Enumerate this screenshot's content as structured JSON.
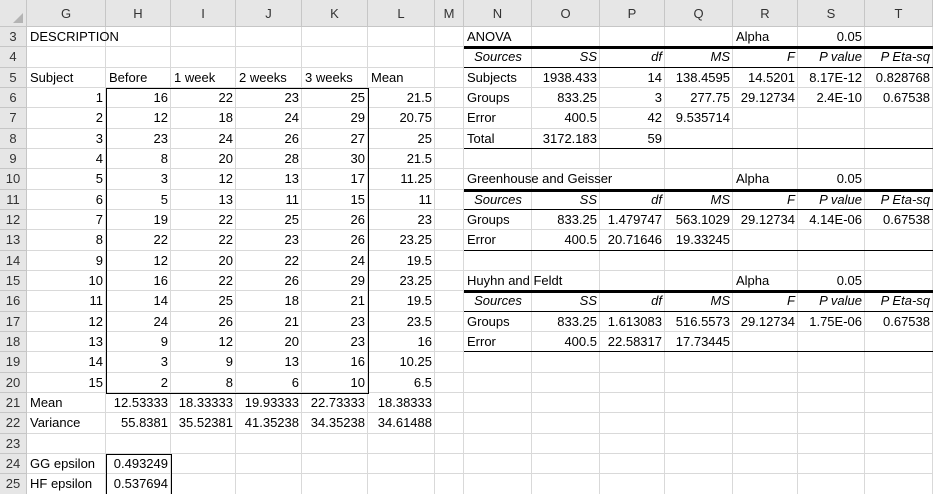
{
  "columns": [
    "G",
    "H",
    "I",
    "J",
    "K",
    "L",
    "M",
    "N",
    "O",
    "P",
    "Q",
    "R",
    "S",
    "T"
  ],
  "rows": [
    "3",
    "4",
    "5",
    "6",
    "7",
    "8",
    "9",
    "10",
    "11",
    "12",
    "13",
    "14",
    "15",
    "16",
    "17",
    "18",
    "19",
    "20",
    "21",
    "22",
    "23",
    "24",
    "25"
  ],
  "left": {
    "title": "DESCRIPTION",
    "headers": [
      "Subject",
      "Before",
      "1 week",
      "2 weeks",
      "3 weeks",
      "Mean"
    ],
    "data": [
      [
        "1",
        "16",
        "22",
        "23",
        "25",
        "21.5"
      ],
      [
        "2",
        "12",
        "18",
        "24",
        "29",
        "20.75"
      ],
      [
        "3",
        "23",
        "24",
        "26",
        "27",
        "25"
      ],
      [
        "4",
        "8",
        "20",
        "28",
        "30",
        "21.5"
      ],
      [
        "5",
        "3",
        "12",
        "13",
        "17",
        "11.25"
      ],
      [
        "6",
        "5",
        "13",
        "11",
        "15",
        "11"
      ],
      [
        "7",
        "19",
        "22",
        "25",
        "26",
        "23"
      ],
      [
        "8",
        "22",
        "22",
        "23",
        "26",
        "23.25"
      ],
      [
        "9",
        "12",
        "20",
        "22",
        "24",
        "19.5"
      ],
      [
        "10",
        "16",
        "22",
        "26",
        "29",
        "23.25"
      ],
      [
        "11",
        "14",
        "25",
        "18",
        "21",
        "19.5"
      ],
      [
        "12",
        "24",
        "26",
        "21",
        "23",
        "23.5"
      ],
      [
        "13",
        "9",
        "12",
        "20",
        "23",
        "16"
      ],
      [
        "14",
        "3",
        "9",
        "13",
        "16",
        "10.25"
      ],
      [
        "15",
        "2",
        "8",
        "6",
        "10",
        "6.5"
      ]
    ],
    "mean_row": [
      "Mean",
      "12.53333",
      "18.33333",
      "19.93333",
      "22.73333",
      "18.38333"
    ],
    "variance_row": [
      "Variance",
      "55.8381",
      "35.52381",
      "41.35238",
      "34.35238",
      "34.61488"
    ],
    "gg": {
      "label": "GG epsilon",
      "value": "0.493249"
    },
    "hf": {
      "label": "HF epsilon",
      "value": "0.537694"
    }
  },
  "anova": {
    "title": "ANOVA",
    "alpha_label": "Alpha",
    "alpha_value": "0.05",
    "headers": [
      "Sources",
      "SS",
      "df",
      "MS",
      "F",
      "P value",
      "P Eta-sq"
    ],
    "rows": [
      [
        "Subjects",
        "1938.433",
        "14",
        "138.4595",
        "14.5201",
        "8.17E-12",
        "0.828768"
      ],
      [
        "Groups",
        "833.25",
        "3",
        "277.75",
        "29.12734",
        "2.4E-10",
        "0.67538"
      ],
      [
        "Error",
        "400.5",
        "42",
        "9.535714",
        "",
        "",
        ""
      ],
      [
        "Total",
        "3172.183",
        "59",
        "",
        "",
        "",
        ""
      ]
    ]
  },
  "gg_table": {
    "title": "Greenhouse and Geisser",
    "alpha_label": "Alpha",
    "alpha_value": "0.05",
    "headers": [
      "Sources",
      "SS",
      "df",
      "MS",
      "F",
      "P value",
      "P Eta-sq"
    ],
    "rows": [
      [
        "Groups",
        "833.25",
        "1.479747",
        "563.1029",
        "29.12734",
        "4.14E-06",
        "0.67538"
      ],
      [
        "Error",
        "400.5",
        "20.71646",
        "19.33245",
        "",
        "",
        ""
      ]
    ]
  },
  "hf_table": {
    "title": "Huyhn and Feldt",
    "alpha_label": "Alpha",
    "alpha_value": "0.05",
    "headers": [
      "Sources",
      "SS",
      "df",
      "MS",
      "F",
      "P value",
      "P Eta-sq"
    ],
    "rows": [
      [
        "Groups",
        "833.25",
        "1.613083",
        "516.5573",
        "29.12734",
        "1.75E-06",
        "0.67538"
      ],
      [
        "Error",
        "400.5",
        "22.58317",
        "17.73445",
        "",
        "",
        ""
      ]
    ]
  }
}
